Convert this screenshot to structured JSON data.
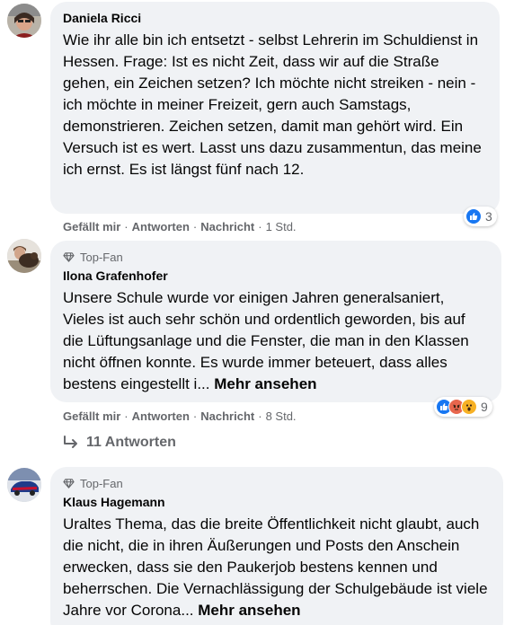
{
  "comments": [
    {
      "author": "Daniela Ricci",
      "badge": "",
      "text": "Wie ihr alle bin ich entsetzt - selbst Lehrerin im Schuldienst in Hessen. Frage: Ist es nicht Zeit, dass wir auf die Straße gehen, ein Zeichen setzen? Ich möchte nicht streiken - nein - ich möchte in meiner Freizeit, gern auch Samstags, demonstrieren. Zeichen setzen, damit man gehört wird. Ein Versuch ist es wert. Lasst uns dazu zusammentun, das meine ich ernst. Es ist längst fünf nach 12.",
      "more": "",
      "actions": {
        "like": "Gefällt mir",
        "reply": "Antworten",
        "message": "Nachricht",
        "time": "1 Std."
      },
      "reaction_count": "3",
      "reaction_icons": [
        "like-icon"
      ]
    },
    {
      "author": "Ilona Grafenhofer",
      "badge": "Top-Fan",
      "text": "Unsere Schule wurde vor einigen Jahren generalsaniert, Vieles ist auch sehr schön und ordentlich geworden, bis auf die Lüftungsanlage und die Fenster, die man in den Klassen nicht öffnen konnte. Es wurde immer beteuert, dass alles bestens eingestellt i...",
      "more": "Mehr ansehen",
      "actions": {
        "like": "Gefällt mir",
        "reply": "Antworten",
        "message": "Nachricht",
        "time": "8 Std."
      },
      "reaction_count": "9",
      "reaction_icons": [
        "like-icon",
        "angry-icon",
        "wow-icon"
      ],
      "replies_label": "11 Antworten"
    },
    {
      "author": "Klaus Hagemann",
      "badge": "Top-Fan",
      "text": "Uraltes Thema, das die breite Öffentlichkeit nicht glaubt, auch die nicht, die in ihren Äußerungen und Posts den Anschein erwecken, dass sie den Paukerjob bestens kennen und beherrschen. Die Vernachlässigung der Schulgebäude ist viele Jahre vor Corona...",
      "more": "Mehr ansehen"
    }
  ],
  "colors": {
    "bubble_bg": "#f0f2f5",
    "meta_text": "#65676b",
    "like_blue": "#1877f2",
    "angry_orange": "#e8664d",
    "wow_yellow": "#f7b125"
  }
}
